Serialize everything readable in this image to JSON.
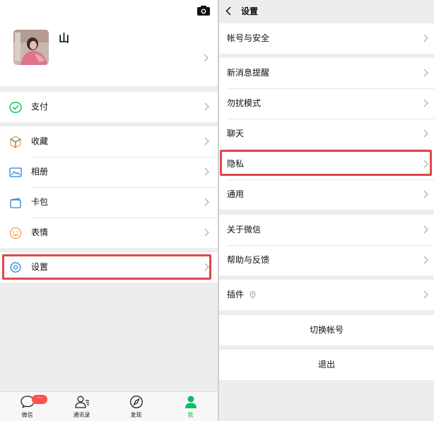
{
  "left": {
    "profile": {
      "name": "山"
    },
    "menu_groups": [
      [
        {
          "label": "支付",
          "icon": "pay-icon"
        }
      ],
      [
        {
          "label": "收藏",
          "icon": "favorites-icon"
        },
        {
          "label": "相册",
          "icon": "album-icon"
        },
        {
          "label": "卡包",
          "icon": "card-wallet-icon"
        },
        {
          "label": "表情",
          "icon": "sticker-icon"
        }
      ],
      [
        {
          "label": "设置",
          "icon": "settings-icon"
        }
      ]
    ],
    "tabs": [
      {
        "label": "微信",
        "icon": "chat-icon",
        "badge": "···"
      },
      {
        "label": "通讯录",
        "icon": "contacts-icon"
      },
      {
        "label": "发现",
        "icon": "discover-icon"
      },
      {
        "label": "我",
        "icon": "me-icon",
        "active": true
      }
    ]
  },
  "right": {
    "title": "设置",
    "groups": [
      [
        "帐号与安全"
      ],
      [
        "新消息提醒",
        "勿扰模式",
        "聊天",
        "隐私",
        "通用"
      ],
      [
        "关于微信",
        "帮助与反馈"
      ],
      [
        "插件"
      ]
    ],
    "switch_account": "切换帐号",
    "logout": "退出"
  },
  "colors": {
    "accent_green": "#07c160",
    "highlight_red": "#e0474c",
    "badge_red": "#fa5151"
  }
}
